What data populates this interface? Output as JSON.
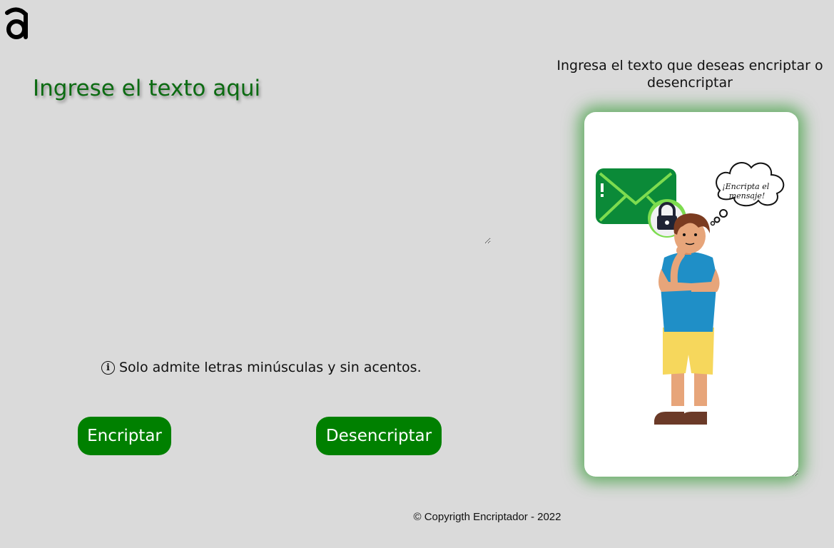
{
  "logo": {
    "icon": "alura-logo-icon"
  },
  "input": {
    "title": "Ingrese el texto aqui",
    "value": "",
    "hint_icon": "info-icon",
    "hint": "Solo admite letras minúsculas y sin acentos."
  },
  "buttons": {
    "encrypt_label": "Encriptar",
    "decrypt_label": "Desencriptar"
  },
  "result": {
    "heading": "Ingresa el texto que deseas encriptar o desencriptar",
    "speech_bubble": "¡Encripta el mensaje!"
  },
  "footer": {
    "copyright": "© Copyrigth Encriptador - 2022"
  },
  "colors": {
    "background": "#dadada",
    "accent_green": "#008000",
    "title_green": "#0c6b12"
  }
}
